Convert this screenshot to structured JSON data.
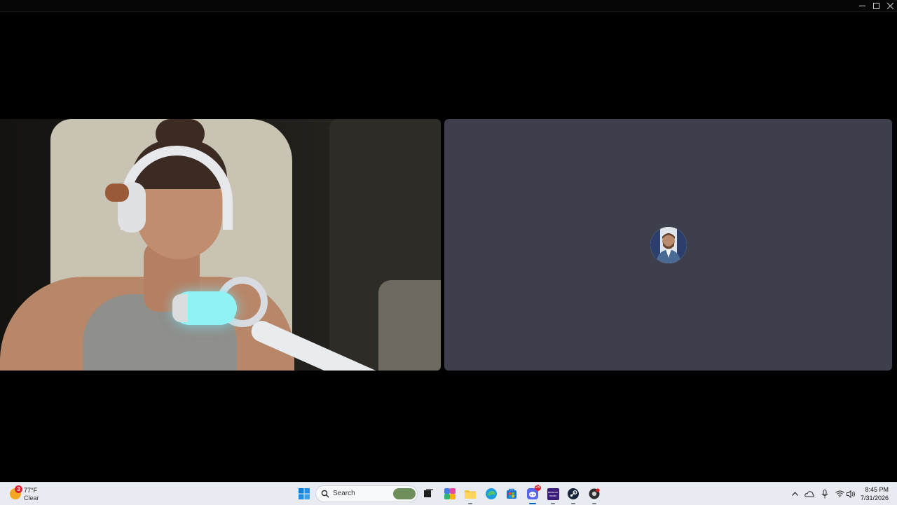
{
  "window": {
    "controls": {
      "minimize_icon": "minimize-icon",
      "maximize_icon": "maximize-icon",
      "close_icon": "close-icon"
    }
  },
  "call": {
    "participants": [
      {
        "type": "video",
        "icon": "camera-feed"
      },
      {
        "type": "avatar",
        "icon": "user-avatar"
      }
    ],
    "colors": {
      "avatar_tile_bg": "#3e3f4c",
      "stage_bg": "#000000"
    }
  },
  "taskbar": {
    "weather": {
      "badge": "3",
      "temp": "77°F",
      "condition": "Clear"
    },
    "search": {
      "placeholder": "Search"
    },
    "apps": [
      {
        "name": "start",
        "icon": "windows-logo-icon"
      },
      {
        "name": "task-view",
        "icon": "task-view-icon"
      },
      {
        "name": "copilot",
        "icon": "copilot-icon"
      },
      {
        "name": "file-explorer",
        "icon": "folder-icon"
      },
      {
        "name": "edge",
        "icon": "edge-icon"
      },
      {
        "name": "store",
        "icon": "store-icon"
      },
      {
        "name": "discord",
        "icon": "discord-icon",
        "badge": "24"
      },
      {
        "name": "amazon-music",
        "icon": "amazon-music-icon",
        "label": "amazon music"
      },
      {
        "name": "steam",
        "icon": "steam-icon"
      },
      {
        "name": "obs",
        "icon": "record-icon"
      }
    ],
    "tray": {
      "icons": [
        "chevron-up-icon",
        "onedrive-icon",
        "microphone-icon",
        "wifi-icon",
        "speaker-icon"
      ]
    },
    "clock": {
      "time": "8:45 PM",
      "date": "7/31/2026"
    }
  }
}
